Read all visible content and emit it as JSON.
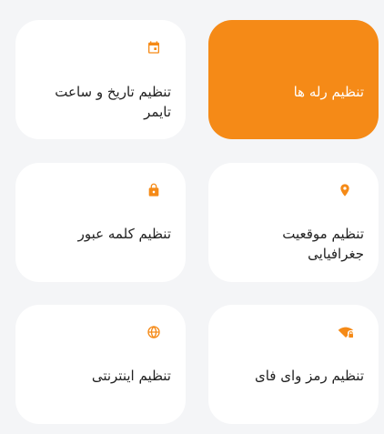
{
  "colors": {
    "accent": "#f58a17",
    "card_bg": "#ffffff",
    "page_bg": "#f4f5f7",
    "text": "#222222"
  },
  "cards": [
    {
      "id": "relays",
      "label": "تنظیم رله ها",
      "icon": "none",
      "active": true
    },
    {
      "id": "datetime",
      "label": "تنظیم تاریخ و ساعت تایمر",
      "icon": "calendar-icon",
      "active": false
    },
    {
      "id": "location",
      "label": "تنظیم موقعیت جغرافیایی",
      "icon": "location-pin-icon",
      "active": false
    },
    {
      "id": "password",
      "label": "تنظیم کلمه عبور",
      "icon": "lock-icon",
      "active": false
    },
    {
      "id": "wifi",
      "label": "تنظیم رمز وای فای",
      "icon": "wifi-lock-icon",
      "active": false
    },
    {
      "id": "internet",
      "label": "تنظیم اینترنتی",
      "icon": "globe-icon",
      "active": false
    }
  ]
}
